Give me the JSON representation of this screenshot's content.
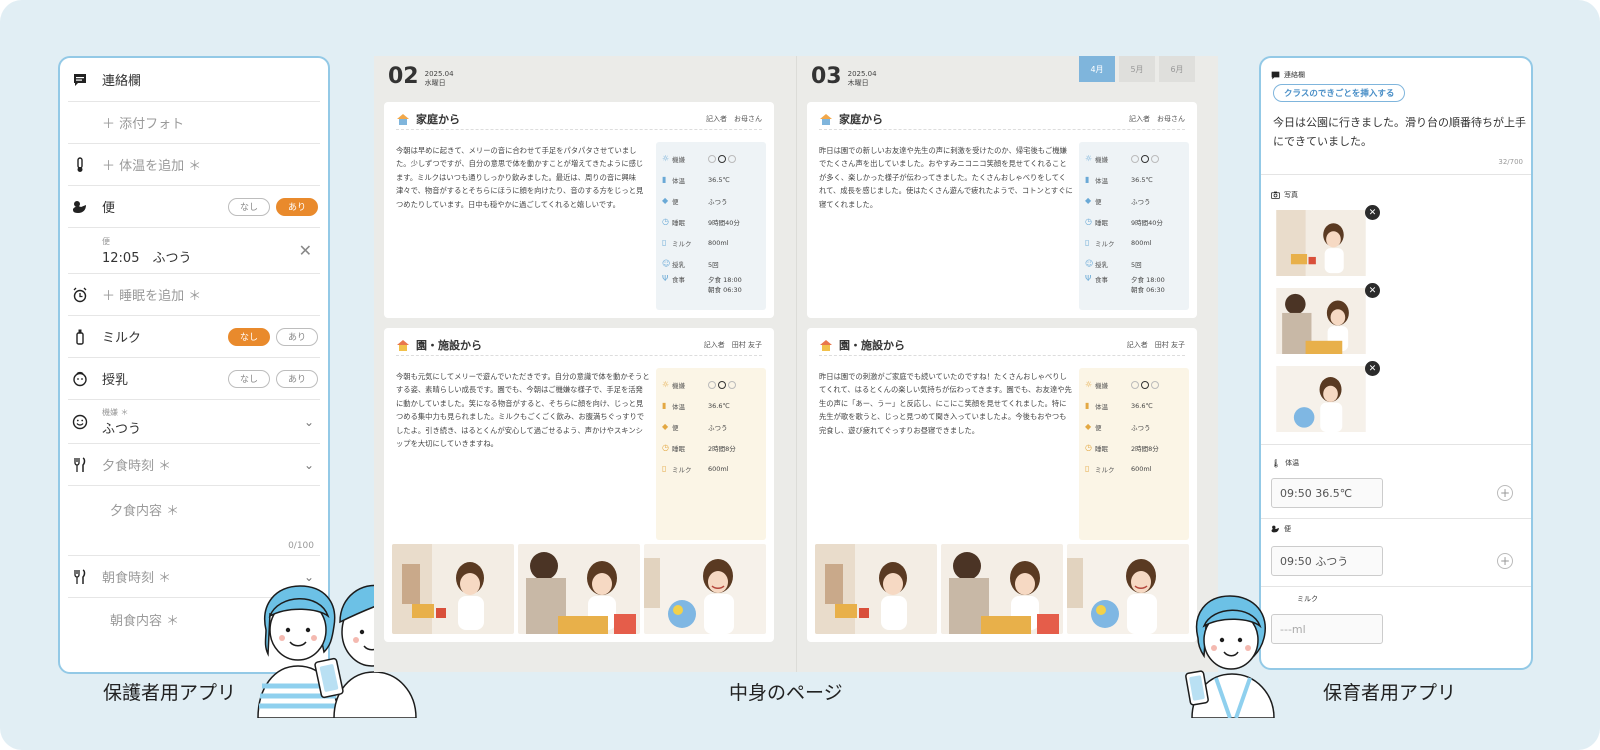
{
  "parent_app": {
    "caption": "保護者用アプリ",
    "rows": {
      "notebook": "連絡欄",
      "photo": "＋ 添付フォト",
      "temp": "＋ 体温を追加 ＊",
      "stool": "便",
      "stool_time_label": "便",
      "stool_entry": "12:05　ふつう",
      "sleep": "＋ 睡眠を追加 ＊",
      "milk": "ミルク",
      "breast": "授乳",
      "mood_label": "機嫌 ＊",
      "mood_value": "ふつう",
      "dinner_time": "夕食時刻 ＊",
      "dinner_content": "夕食内容 ＊",
      "dinner_count": "0/100",
      "breakfast_time": "朝食時刻 ＊",
      "breakfast_content": "朝食内容 ＊"
    },
    "pill_none": "なし",
    "pill_yes": "あり"
  },
  "book": {
    "caption": "中身のページ",
    "month_tabs": [
      "4月",
      "5月",
      "6月"
    ],
    "pages": [
      {
        "day": "02",
        "date": "2025.04",
        "weekday": "水曜日",
        "home": {
          "title": "家庭から",
          "by": "記入者　お母さん",
          "text": "今朝は早めに起きて、メリーの音に合わせて手足をパタパタさせていました。少しずつですが、自分の意思で体を動かすことが増えてきたように感じます。ミルクはいつも通りしっかり飲みました。最近は、周りの音に興味津々で、物音がするとそちらにほうに顔を向けたり、音のする方をじっと見つめたりしています。日中も穏やかに過ごしてくれると嬉しいです。",
          "stats": [
            {
              "label": "機嫌",
              "value": ""
            },
            {
              "label": "体温",
              "value": "36.5℃"
            },
            {
              "label": "便",
              "value": "ふつう"
            },
            {
              "label": "睡眠",
              "value": "9時間40分"
            },
            {
              "label": "ミルク",
              "value": "800ml"
            },
            {
              "label": "授乳",
              "value": "5回"
            },
            {
              "label": "食事",
              "value": "夕食 18:00\n朝食 06:30"
            }
          ]
        },
        "school": {
          "title": "園・施設から",
          "by": "記入者　田村 友子",
          "text": "今朝も元気にしてメリーで遊んでいただきです。自分の意識で体を動かそうとする姿、素晴らしい成長です。園でも、今朝はご機嫌な様子で、手足を活発に動かしていました。笑になる物音がすると、そちらに顔を向け、じっと見つめる集中力も見られました。ミルクもごくごく飲み、お腹満ちぐっすりでしたよ。引き続き、はるとくんが安心して過ごせるよう、声かけやスキンシップを大切にしていきますね。",
          "stats": [
            {
              "label": "機嫌",
              "value": ""
            },
            {
              "label": "体温",
              "value": "36.6℃"
            },
            {
              "label": "便",
              "value": "ふつう"
            },
            {
              "label": "睡眠",
              "value": "2時間8分"
            },
            {
              "label": "ミルク",
              "value": "600ml"
            }
          ]
        }
      },
      {
        "day": "03",
        "date": "2025.04",
        "weekday": "木曜日",
        "home": {
          "title": "家庭から",
          "by": "記入者　お母さん",
          "text": "昨日は園での新しいお友達や先生の声に刺激を受けたのか、帰宅後もご機嫌でたくさん声を出していました。おやすみニコニコ笑顔を見せてくれることが多く、楽しかった様子が伝わってきました。たくさんおしゃべりをしてくれて、成長を感じました。使はたくさん遊んで疲れたようで、コトンとすぐに寝てくれました。",
          "stats": [
            {
              "label": "機嫌",
              "value": ""
            },
            {
              "label": "体温",
              "value": "36.5℃"
            },
            {
              "label": "便",
              "value": "ふつう"
            },
            {
              "label": "睡眠",
              "value": "9時間40分"
            },
            {
              "label": "ミルク",
              "value": "800ml"
            },
            {
              "label": "授乳",
              "value": "5回"
            },
            {
              "label": "食事",
              "value": "夕食 18:00\n朝食 06:30"
            }
          ]
        },
        "school": {
          "title": "園・施設から",
          "by": "記入者　田村 友子",
          "text": "昨日は園での刺激がご家庭でも続いていたのですね！たくさんおしゃべりしてくれて、はるとくんの楽しい気持ちが伝わってきます。園でも、お友達や先生の声に「あー、うー」と反応し、にこにこ笑顔を見せてくれました。特に先生が歌を歌うと、じっと見つめて聞き入っていましたよ。今後もおやつも完食し、遊び疲れてぐっすりお昼寝できました。",
          "stats": [
            {
              "label": "機嫌",
              "value": ""
            },
            {
              "label": "体温",
              "value": "36.6℃"
            },
            {
              "label": "便",
              "value": "ふつう"
            },
            {
              "label": "睡眠",
              "value": "2時間8分"
            },
            {
              "label": "ミルク",
              "value": "600ml"
            }
          ]
        }
      }
    ]
  },
  "staff_app": {
    "caption": "保育者用アプリ",
    "title": "連絡欄",
    "insert_button": "クラスのできごとを挿入する",
    "message": "今日は公園に行きました。滑り台の順番待ちが上手にできていました。",
    "count": "32/700",
    "photo_label": "写真",
    "temp_label": "体温",
    "temp_value": "09:50 36.5℃",
    "stool_label": "便",
    "stool_value": "09:50 ふつう",
    "milk_label": "ミルク",
    "milk_placeholder": "---ml"
  },
  "colors": {
    "background": "#e1eef4",
    "accent_blue": "#93c9e6",
    "accent_orange": "#e98a2c"
  }
}
